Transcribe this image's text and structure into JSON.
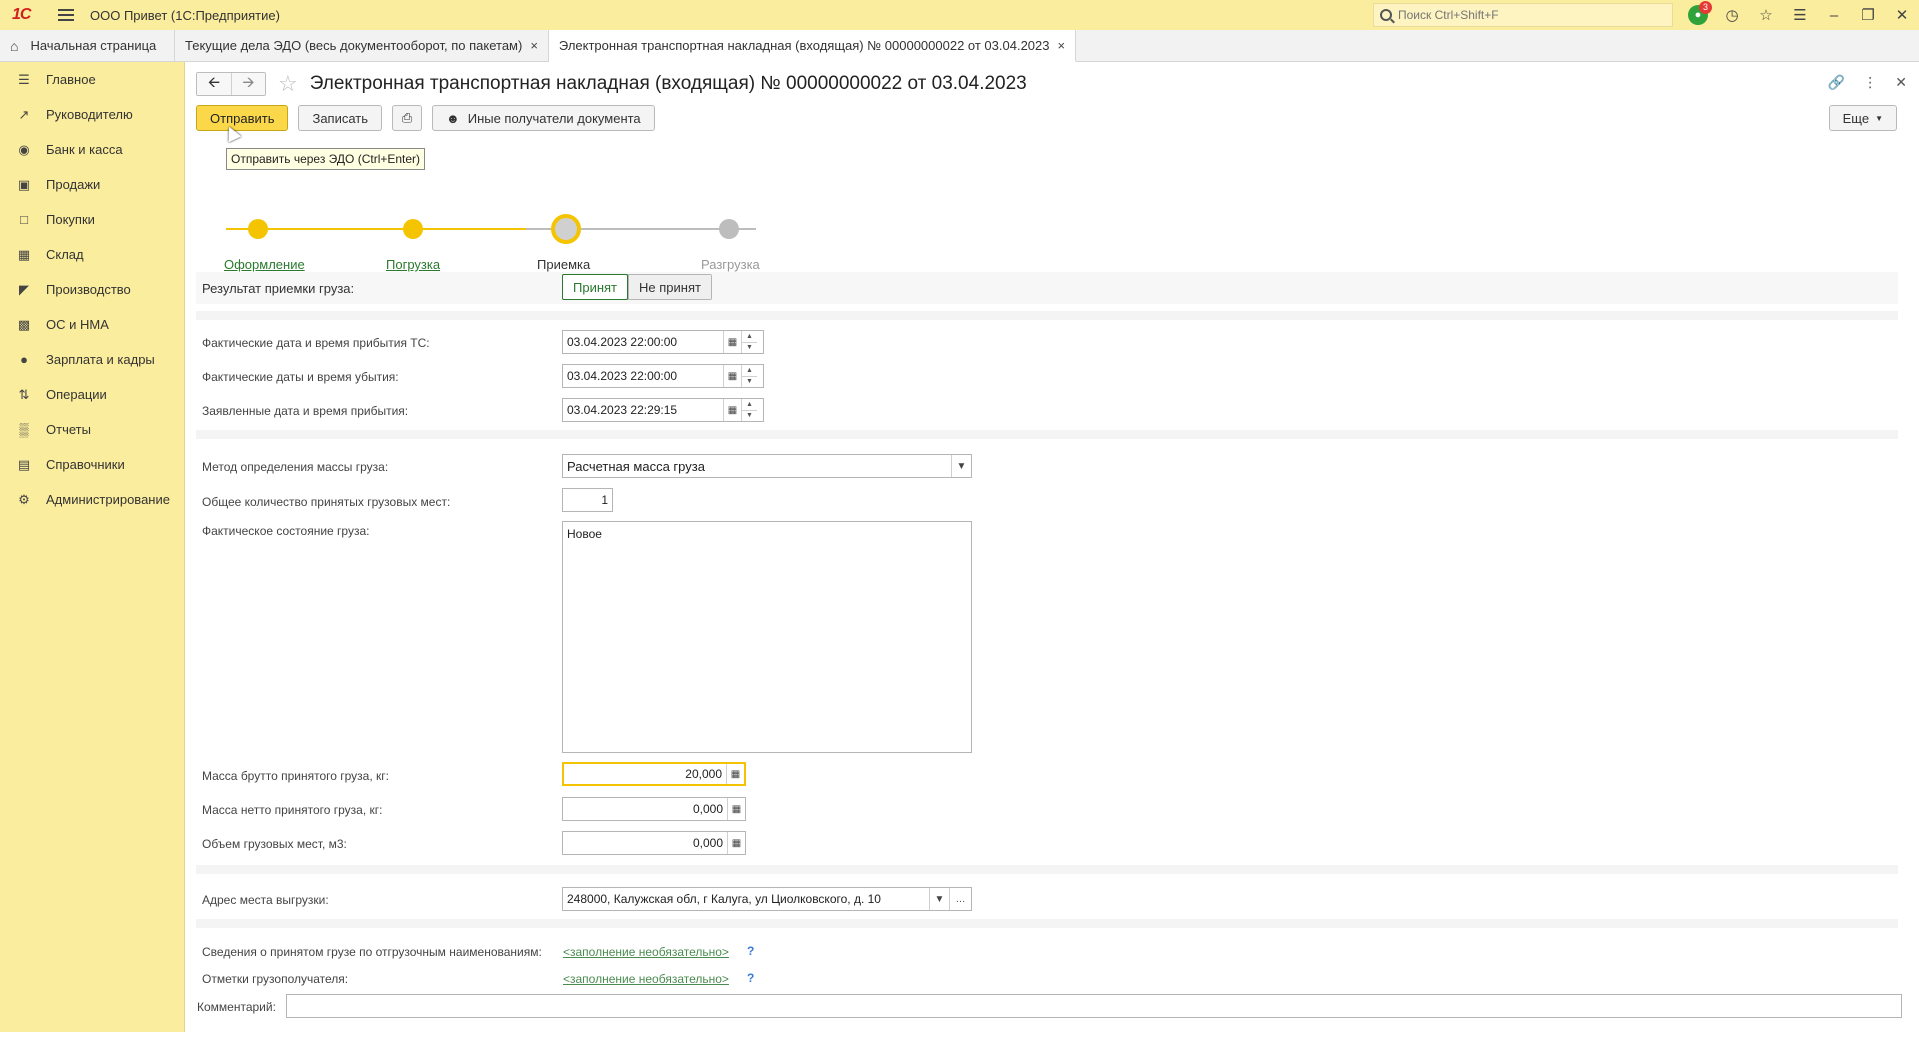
{
  "app": {
    "title": "ООО Привет (1С:Предприятие)",
    "logo_text": "1С",
    "search_placeholder": "Поиск Ctrl+Shift+F",
    "notifications_count": "3"
  },
  "tabs": [
    {
      "label": "Начальная страница"
    },
    {
      "label": "Текущие дела ЭДО (весь документооборот, по пакетам)"
    },
    {
      "label": "Электронная транспортная накладная (входящая) № 00000000022 от 03.04.2023"
    }
  ],
  "sidebar": {
    "items": [
      {
        "label": "Главное",
        "icon": "menu-icon"
      },
      {
        "label": "Руководителю",
        "icon": "trend-icon"
      },
      {
        "label": "Банк и касса",
        "icon": "bank-icon"
      },
      {
        "label": "Продажи",
        "icon": "shopping-bag-icon"
      },
      {
        "label": "Покупки",
        "icon": "cart-icon"
      },
      {
        "label": "Склад",
        "icon": "warehouse-icon"
      },
      {
        "label": "Производство",
        "icon": "factory-icon"
      },
      {
        "label": "ОС и НМА",
        "icon": "truck-icon"
      },
      {
        "label": "Зарплата и кадры",
        "icon": "person-icon"
      },
      {
        "label": "Операции",
        "icon": "operations-icon"
      },
      {
        "label": "Отчеты",
        "icon": "bar-chart-icon"
      },
      {
        "label": "Справочники",
        "icon": "book-icon"
      },
      {
        "label": "Администрирование",
        "icon": "gear-icon"
      }
    ]
  },
  "document": {
    "title": "Электронная транспортная накладная (входящая) № 00000000022 от 03.04.2023"
  },
  "toolbar": {
    "send_label": "Отправить",
    "save_label": "Записать",
    "other_recipients_label": "Иные получатели документа",
    "more_label": "Еще",
    "tooltip": "Отправить через ЭДО (Ctrl+Enter)"
  },
  "steps": [
    {
      "label": "Оформление",
      "state": "done"
    },
    {
      "label": "Погрузка",
      "state": "done"
    },
    {
      "label": "Приемка",
      "state": "current"
    },
    {
      "label": "Разгрузка",
      "state": "todo"
    }
  ],
  "form": {
    "result_label": "Результат приемки груза:",
    "result_options": [
      "Принят",
      "Не принят"
    ],
    "result_selected": "Принят",
    "arrival_actual_label": "Фактические дата и время прибытия ТС:",
    "arrival_actual_value": "03.04.2023 22:00:00",
    "departure_actual_label": "Фактические даты и время убытия:",
    "departure_actual_value": "03.04.2023 22:00:00",
    "arrival_declared_label": "Заявленные дата и время прибытия:",
    "arrival_declared_value": "03.04.2023 22:29:15",
    "mass_method_label": "Метод определения массы груза:",
    "mass_method_value": "Расчетная масса груза",
    "places_count_label": "Общее количество принятых грузовых мест:",
    "places_count_value": "1",
    "cargo_state_label": "Фактическое состояние груза:",
    "cargo_state_value": "Новое",
    "gross_mass_label": "Масса брутто принятого груза, кг:",
    "gross_mass_value": "20,000",
    "net_mass_label": "Масса нетто принятого груза, кг:",
    "net_mass_value": "0,000",
    "volume_label": "Объем грузовых мест, м3:",
    "volume_value": "0,000",
    "unload_address_label": "Адрес места выгрузки:",
    "unload_address_value": "248000, Калужская обл, г Калуга, ул Циолковского, д. 10",
    "cargo_info_label": "Сведения о принятом грузе по отгрузочным наименованиям:",
    "cargo_info_link": "<заполнение необязательно>",
    "consignee_marks_label": "Отметки грузополучателя:",
    "consignee_marks_link": "<заполнение необязательно>",
    "comment_label": "Комментарий:",
    "comment_value": "",
    "help_glyph": "?"
  },
  "colors": {
    "topbar": "#fbed9e",
    "primary_button": "#fbd84a",
    "link_green": "#2a7a2e",
    "step_done": "#f5c400"
  }
}
